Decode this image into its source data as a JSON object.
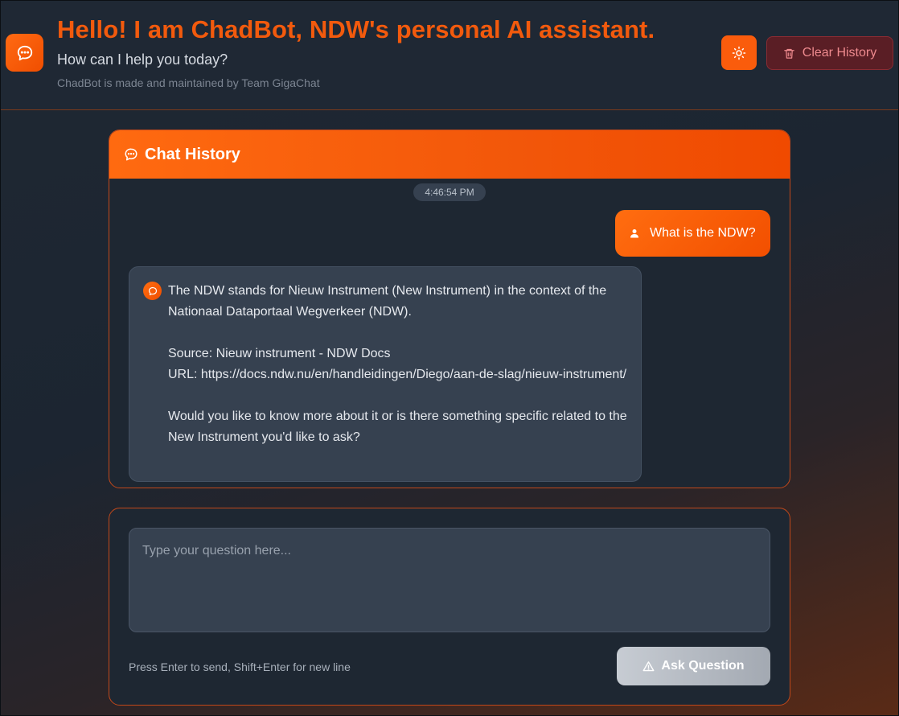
{
  "header": {
    "title": "Hello! I am ChadBot, NDW's personal AI assistant.",
    "subtitle": "How can I help you today?",
    "credit": "ChadBot is made and maintained by Team GigaChat",
    "logo_icon": "chat-bubble-icon",
    "theme_icon": "sun-icon",
    "clear_label": "Clear History",
    "clear_icon": "trash-icon"
  },
  "history": {
    "title": "Chat History",
    "title_icon": "chat-bubble-icon",
    "timestamp": "4:46:54 PM",
    "messages": [
      {
        "role": "user",
        "icon": "user-icon",
        "text": "What is the NDW?"
      },
      {
        "role": "assistant",
        "icon": "chat-bubble-icon",
        "paragraphs": [
          "The NDW stands for Nieuw Instrument (New Instrument) in the context of the Nationaal Dataportaal Wegverkeer (NDW).",
          "Source: Nieuw instrument - NDW Docs",
          "URL: https://docs.ndw.nu/en/handleidingen/Diego/aan-de-slag/nieuw-instrument/",
          "Would you like to know more about it or is there something specific related to the New Instrument you'd like to ask?"
        ]
      }
    ]
  },
  "input": {
    "placeholder": "Type your question here...",
    "value": "",
    "hint": "Press Enter to send, Shift+Enter for new line",
    "ask_label": "Ask Question",
    "ask_icon": "warning-icon"
  },
  "colors": {
    "accent": "#f25a0d",
    "accent_gradient_start": "#ff6a10",
    "accent_gradient_end": "#f04a00",
    "danger_bg": "#5a1e25",
    "danger_text": "#ee8a8e",
    "panel_bg": "#1e2732",
    "bubble_bg": "#364150"
  }
}
